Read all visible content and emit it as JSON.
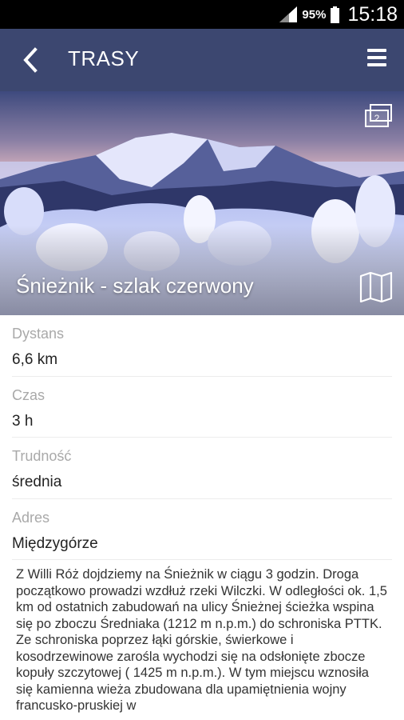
{
  "status_bar": {
    "battery_percent": "95%",
    "time": "15:18"
  },
  "app_bar": {
    "title": "TRASY",
    "back_icon": "back-arrow-icon",
    "menu_icon": "hamburger-menu-icon"
  },
  "hero": {
    "title": "Śnieżnik - szlak czerwony",
    "photo_count": "2",
    "gallery_icon": "photo-gallery-icon",
    "map_icon": "map-icon"
  },
  "details": [
    {
      "label": "Dystans",
      "value": "6,6 km"
    },
    {
      "label": "Czas",
      "value": "3 h"
    },
    {
      "label": "Trudność",
      "value": "średnia"
    },
    {
      "label": "Adres",
      "value": "Międzygórze"
    }
  ],
  "description": "Z Willi Róż dojdziemy na Śnieżnik w ciągu 3 godzin. Droga początkowo prowadzi wzdłuż rzeki Wilczki. W odległości ok. 1,5 km od ostatnich zabudowań na ulicy Śnieżnej ścieżka wspina się po zboczu Średniaka (1212 m n.p.m.) do schroniska PTTK.  Ze schroniska poprzez łąki górskie,  świerkowe i kosodrzewinowe zarośla wychodzi się na odsłonięte zbocze kopuły szczytowej ( 1425 m n.p.m.). W tym miejscu wznosiła się kamienna wieża zbudowana dla upamiętnienia wojny francusko-pruskiej w",
  "colors": {
    "app_bar": "#3c4770",
    "label": "#a9a9a9",
    "value": "#222222"
  }
}
